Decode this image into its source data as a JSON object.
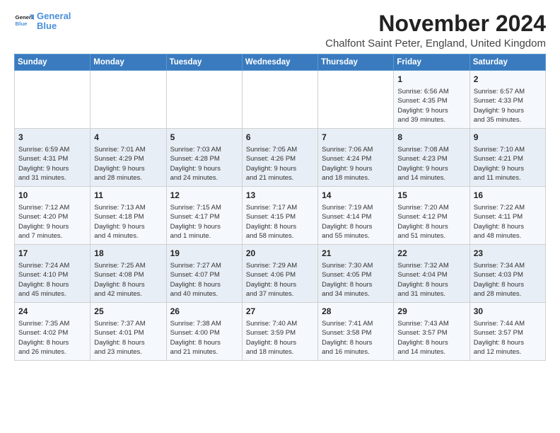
{
  "logo": {
    "line1": "General",
    "line2": "Blue"
  },
  "title": "November 2024",
  "location": "Chalfont Saint Peter, England, United Kingdom",
  "days_of_week": [
    "Sunday",
    "Monday",
    "Tuesday",
    "Wednesday",
    "Thursday",
    "Friday",
    "Saturday"
  ],
  "weeks": [
    [
      {
        "day": "",
        "data": ""
      },
      {
        "day": "",
        "data": ""
      },
      {
        "day": "",
        "data": ""
      },
      {
        "day": "",
        "data": ""
      },
      {
        "day": "",
        "data": ""
      },
      {
        "day": "1",
        "data": "Sunrise: 6:56 AM\nSunset: 4:35 PM\nDaylight: 9 hours\nand 39 minutes."
      },
      {
        "day": "2",
        "data": "Sunrise: 6:57 AM\nSunset: 4:33 PM\nDaylight: 9 hours\nand 35 minutes."
      }
    ],
    [
      {
        "day": "3",
        "data": "Sunrise: 6:59 AM\nSunset: 4:31 PM\nDaylight: 9 hours\nand 31 minutes."
      },
      {
        "day": "4",
        "data": "Sunrise: 7:01 AM\nSunset: 4:29 PM\nDaylight: 9 hours\nand 28 minutes."
      },
      {
        "day": "5",
        "data": "Sunrise: 7:03 AM\nSunset: 4:28 PM\nDaylight: 9 hours\nand 24 minutes."
      },
      {
        "day": "6",
        "data": "Sunrise: 7:05 AM\nSunset: 4:26 PM\nDaylight: 9 hours\nand 21 minutes."
      },
      {
        "day": "7",
        "data": "Sunrise: 7:06 AM\nSunset: 4:24 PM\nDaylight: 9 hours\nand 18 minutes."
      },
      {
        "day": "8",
        "data": "Sunrise: 7:08 AM\nSunset: 4:23 PM\nDaylight: 9 hours\nand 14 minutes."
      },
      {
        "day": "9",
        "data": "Sunrise: 7:10 AM\nSunset: 4:21 PM\nDaylight: 9 hours\nand 11 minutes."
      }
    ],
    [
      {
        "day": "10",
        "data": "Sunrise: 7:12 AM\nSunset: 4:20 PM\nDaylight: 9 hours\nand 7 minutes."
      },
      {
        "day": "11",
        "data": "Sunrise: 7:13 AM\nSunset: 4:18 PM\nDaylight: 9 hours\nand 4 minutes."
      },
      {
        "day": "12",
        "data": "Sunrise: 7:15 AM\nSunset: 4:17 PM\nDaylight: 9 hours\nand 1 minute."
      },
      {
        "day": "13",
        "data": "Sunrise: 7:17 AM\nSunset: 4:15 PM\nDaylight: 8 hours\nand 58 minutes."
      },
      {
        "day": "14",
        "data": "Sunrise: 7:19 AM\nSunset: 4:14 PM\nDaylight: 8 hours\nand 55 minutes."
      },
      {
        "day": "15",
        "data": "Sunrise: 7:20 AM\nSunset: 4:12 PM\nDaylight: 8 hours\nand 51 minutes."
      },
      {
        "day": "16",
        "data": "Sunrise: 7:22 AM\nSunset: 4:11 PM\nDaylight: 8 hours\nand 48 minutes."
      }
    ],
    [
      {
        "day": "17",
        "data": "Sunrise: 7:24 AM\nSunset: 4:10 PM\nDaylight: 8 hours\nand 45 minutes."
      },
      {
        "day": "18",
        "data": "Sunrise: 7:25 AM\nSunset: 4:08 PM\nDaylight: 8 hours\nand 42 minutes."
      },
      {
        "day": "19",
        "data": "Sunrise: 7:27 AM\nSunset: 4:07 PM\nDaylight: 8 hours\nand 40 minutes."
      },
      {
        "day": "20",
        "data": "Sunrise: 7:29 AM\nSunset: 4:06 PM\nDaylight: 8 hours\nand 37 minutes."
      },
      {
        "day": "21",
        "data": "Sunrise: 7:30 AM\nSunset: 4:05 PM\nDaylight: 8 hours\nand 34 minutes."
      },
      {
        "day": "22",
        "data": "Sunrise: 7:32 AM\nSunset: 4:04 PM\nDaylight: 8 hours\nand 31 minutes."
      },
      {
        "day": "23",
        "data": "Sunrise: 7:34 AM\nSunset: 4:03 PM\nDaylight: 8 hours\nand 28 minutes."
      }
    ],
    [
      {
        "day": "24",
        "data": "Sunrise: 7:35 AM\nSunset: 4:02 PM\nDaylight: 8 hours\nand 26 minutes."
      },
      {
        "day": "25",
        "data": "Sunrise: 7:37 AM\nSunset: 4:01 PM\nDaylight: 8 hours\nand 23 minutes."
      },
      {
        "day": "26",
        "data": "Sunrise: 7:38 AM\nSunset: 4:00 PM\nDaylight: 8 hours\nand 21 minutes."
      },
      {
        "day": "27",
        "data": "Sunrise: 7:40 AM\nSunset: 3:59 PM\nDaylight: 8 hours\nand 18 minutes."
      },
      {
        "day": "28",
        "data": "Sunrise: 7:41 AM\nSunset: 3:58 PM\nDaylight: 8 hours\nand 16 minutes."
      },
      {
        "day": "29",
        "data": "Sunrise: 7:43 AM\nSunset: 3:57 PM\nDaylight: 8 hours\nand 14 minutes."
      },
      {
        "day": "30",
        "data": "Sunrise: 7:44 AM\nSunset: 3:57 PM\nDaylight: 8 hours\nand 12 minutes."
      }
    ]
  ]
}
